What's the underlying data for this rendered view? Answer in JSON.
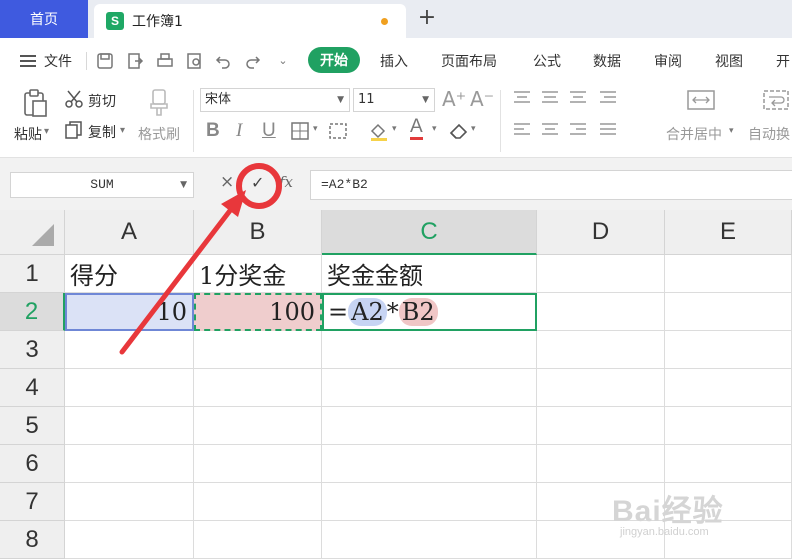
{
  "tabs": {
    "home": "首页",
    "doc": "工作簿1",
    "add": "+"
  },
  "menu": {
    "file": "文件",
    "start": "开始",
    "insert": "插入",
    "layout": "页面布局",
    "formula": "公式",
    "data": "数据",
    "review": "审阅",
    "view": "视图",
    "dev": "开"
  },
  "ribbon": {
    "paste": "粘贴",
    "cut": "剪切",
    "copy": "复制",
    "format_painter": "格式刷",
    "font_name": "宋体",
    "font_size": "11",
    "merge": "合并居中",
    "wrap": "自动换"
  },
  "formula_bar": {
    "name_box": "SUM",
    "cancel": "×",
    "confirm": "✓",
    "fx": "fx",
    "content": "=A2*B2"
  },
  "grid": {
    "columns": [
      "A",
      "B",
      "C",
      "D",
      "E"
    ],
    "rows": [
      "1",
      "2",
      "3",
      "4",
      "5",
      "6",
      "7",
      "8"
    ],
    "a1": "得分",
    "b1": "1分奖金",
    "c1": "奖金金额",
    "a2": "10",
    "b2": "100",
    "c2_eq": "=",
    "c2_ref_a": "A2",
    "c2_op": "*",
    "c2_ref_b": "B2"
  },
  "watermark": {
    "brand": "Bai经验",
    "url": "jingyan.baidu.com"
  },
  "colors": {
    "accent": "#20a162",
    "home_tab": "#3f5adf",
    "highlight": "#e8373b"
  }
}
